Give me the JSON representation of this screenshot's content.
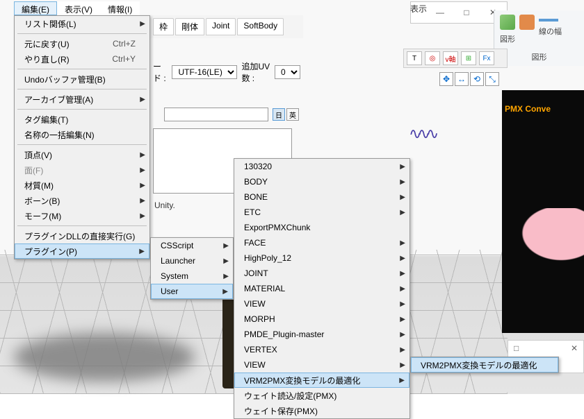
{
  "menubar": {
    "edit": "編集(E)",
    "view": "表示(V)",
    "info": "情報(I)"
  },
  "editMenu": {
    "list": "リスト関係(L)",
    "undo": "元に戻す(U)",
    "undo_sc": "Ctrl+Z",
    "redo": "やり直し(R)",
    "redo_sc": "Ctrl+Y",
    "undoBuf": "Undoバッファ管理(B)",
    "archive": "アーカイブ管理(A)",
    "tagEdit": "タグ編集(T)",
    "batchName": "名称の一括編集(N)",
    "vertex": "頂点(V)",
    "face": "面(F)",
    "material": "材質(M)",
    "bone": "ボーン(B)",
    "morph": "モーフ(M)",
    "pluginDll": "プラグインDLLの直接実行(G)",
    "plugin": "プラグイン(P)"
  },
  "pluginSub": {
    "csscript": "CSScript",
    "launcher": "Launcher",
    "system": "System",
    "user": "User"
  },
  "userSub": {
    "i0": "130320",
    "i1": "BODY",
    "i2": "BONE",
    "i3": "ETC",
    "i4": "ExportPMXChunk",
    "i5": "FACE",
    "i6": "HighPoly_12",
    "i7": "JOINT",
    "i8": "MATERIAL",
    "i9": "VIEW",
    "i10": "MORPH",
    "i11": "PMDE_Plugin-master",
    "i12": "VERTEX",
    "i13": "VIEW",
    "i14": "VRM2PMX変換モデルの最適化",
    "i15": "ウェイト読込/設定(PMX)",
    "i16": "ウェイト保存(PMX)"
  },
  "finalSub": {
    "item": "VRM2PMX変換モデルの最適化"
  },
  "editor": {
    "tabs": {
      "t1": "枠",
      "t2": "剛体",
      "t3": "Joint",
      "t4": "SoftBody"
    },
    "encLabel": "ード :",
    "enc": "UTF-16(LE)",
    "uvLabel": "追加UV数 :",
    "uvVal": "0",
    "jp": "日",
    "en": "英",
    "unity": "Unity."
  },
  "ribbon": {
    "shape": "図形",
    "lineW": "線の幅",
    "shape2": "図形",
    "view": "表示"
  },
  "toolbar": {
    "t": "T",
    "vaxis": "v軸",
    "fx": "Fx"
  },
  "darkPanel": {
    "title": "PMX Conve"
  },
  "winMin": "—",
  "winMax": "□",
  "winClose": "✕"
}
